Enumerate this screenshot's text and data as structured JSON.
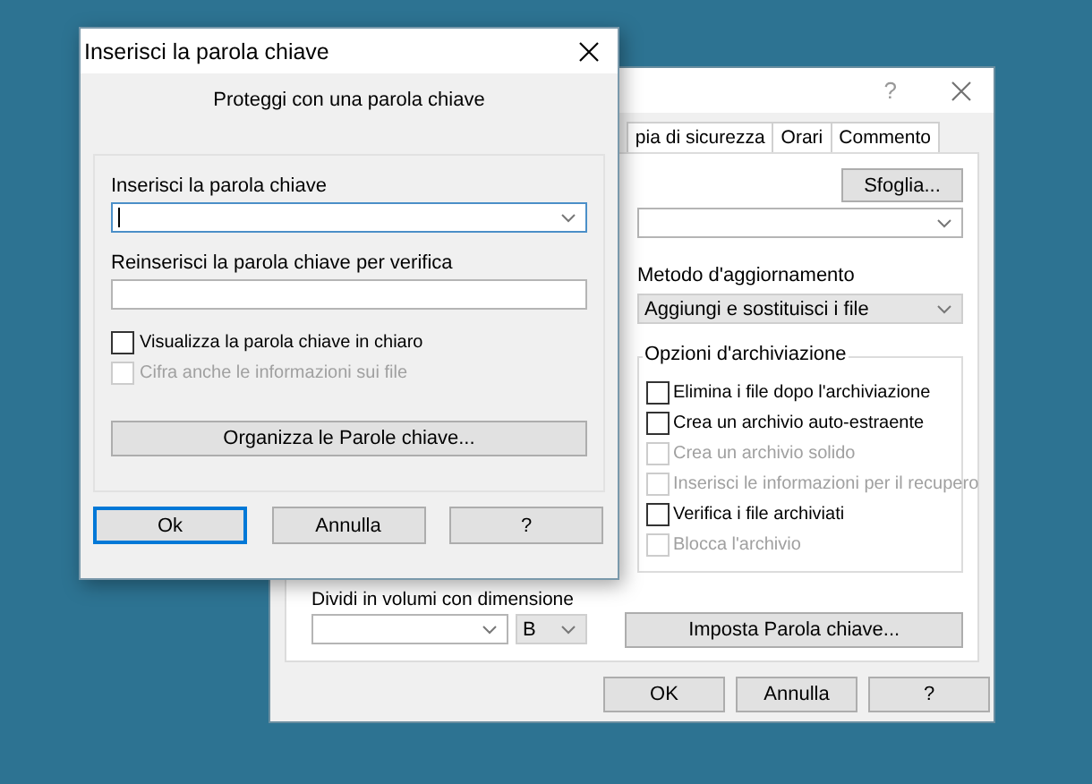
{
  "back_window": {
    "help": "?",
    "tabs": [
      {
        "label": "pia di sicurezza",
        "selected": false
      },
      {
        "label": "Orari",
        "selected": false
      },
      {
        "label": "Commento",
        "selected": false
      }
    ],
    "browse_button": "Sfoglia...",
    "update_method": {
      "label": "Metodo d'aggiornamento",
      "value": "Aggiungi e sostituisci i file"
    },
    "options": {
      "title": "Opzioni d'archiviazione",
      "items": [
        {
          "label": "Elimina i file dopo l'archiviazione",
          "checked": false,
          "disabled": false
        },
        {
          "label": "Crea un archivio auto-estraente",
          "checked": false,
          "disabled": false
        },
        {
          "label": "Crea un archivio solido",
          "checked": false,
          "disabled": true
        },
        {
          "label": "Inserisci le informazioni per il recupero",
          "checked": false,
          "disabled": true
        },
        {
          "label": "Verifica i file archiviati",
          "checked": false,
          "disabled": false
        },
        {
          "label": "Blocca l'archivio",
          "checked": false,
          "disabled": true
        }
      ]
    },
    "split": {
      "label": "Dividi in volumi con dimensione",
      "unit": "B"
    },
    "password_button": "Imposta Parola chiave...",
    "buttons": [
      {
        "label": "OK",
        "default": false
      },
      {
        "label": "Annulla",
        "default": false
      },
      {
        "label": "?",
        "default": false
      }
    ]
  },
  "password_dialog": {
    "title": "Inserisci la parola chiave",
    "heading": "Proteggi con una parola chiave",
    "password": {
      "label": "Inserisci la parola chiave",
      "focused": true
    },
    "confirm": {
      "label": "Reinserisci la parola chiave per verifica",
      "focused": false
    },
    "checkboxes": [
      {
        "label": "Visualizza la parola chiave in chiaro",
        "checked": false,
        "disabled": false
      },
      {
        "label": "Cifra anche le informazioni sui file",
        "checked": false,
        "disabled": true
      }
    ],
    "manage_button": "Organizza le Parole chiave...",
    "buttons": [
      {
        "label": "Ok",
        "default": true
      },
      {
        "label": "Annulla",
        "default": false
      },
      {
        "label": "?",
        "default": false
      }
    ]
  }
}
